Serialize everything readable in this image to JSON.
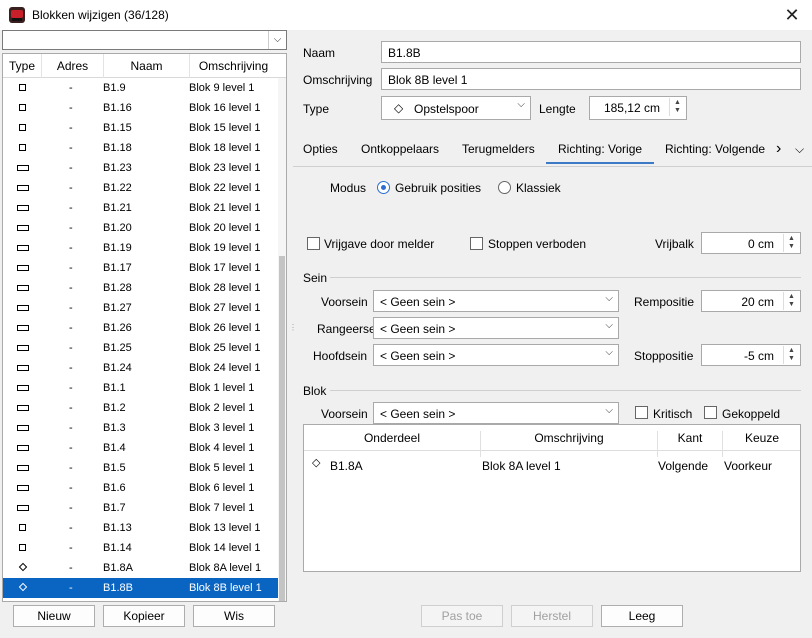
{
  "window": {
    "title": "Blokken wijzigen (36/128)",
    "close": "✕"
  },
  "filter": {
    "value": "",
    "arrow": "⌵"
  },
  "list": {
    "columns": [
      "Type",
      "Adres",
      "Naam",
      "Omschrijving"
    ],
    "rows": [
      {
        "icon": "square",
        "adres": "-",
        "naam": "B1.9",
        "oms": "Blok 9 level 1"
      },
      {
        "icon": "square",
        "adres": "-",
        "naam": "B1.16",
        "oms": "Blok 16 level 1"
      },
      {
        "icon": "square",
        "adres": "-",
        "naam": "B1.15",
        "oms": "Blok 15 level 1"
      },
      {
        "icon": "square",
        "adres": "-",
        "naam": "B1.18",
        "oms": "Blok 18 level 1"
      },
      {
        "icon": "rect",
        "adres": "-",
        "naam": "B1.23",
        "oms": "Blok 23 level 1"
      },
      {
        "icon": "rect",
        "adres": "-",
        "naam": "B1.22",
        "oms": "Blok 22 level 1"
      },
      {
        "icon": "rect",
        "adres": "-",
        "naam": "B1.21",
        "oms": "Blok 21 level 1"
      },
      {
        "icon": "rect",
        "adres": "-",
        "naam": "B1.20",
        "oms": "Blok 20 level 1"
      },
      {
        "icon": "rect",
        "adres": "-",
        "naam": "B1.19",
        "oms": "Blok 19 level 1"
      },
      {
        "icon": "rect",
        "adres": "-",
        "naam": "B1.17",
        "oms": "Blok 17 level 1"
      },
      {
        "icon": "rect",
        "adres": "-",
        "naam": "B1.28",
        "oms": "Blok 28 level 1"
      },
      {
        "icon": "rect",
        "adres": "-",
        "naam": "B1.27",
        "oms": "Blok 27 level 1"
      },
      {
        "icon": "rect",
        "adres": "-",
        "naam": "B1.26",
        "oms": "Blok 26 level 1"
      },
      {
        "icon": "rect",
        "adres": "-",
        "naam": "B1.25",
        "oms": "Blok 25 level 1"
      },
      {
        "icon": "rect",
        "adres": "-",
        "naam": "B1.24",
        "oms": "Blok 24 level 1"
      },
      {
        "icon": "rect",
        "adres": "-",
        "naam": "B1.1",
        "oms": "Blok 1 level 1"
      },
      {
        "icon": "rect",
        "adres": "-",
        "naam": "B1.2",
        "oms": "Blok 2 level 1"
      },
      {
        "icon": "rect",
        "adres": "-",
        "naam": "B1.3",
        "oms": "Blok 3 level 1"
      },
      {
        "icon": "rect",
        "adres": "-",
        "naam": "B1.4",
        "oms": "Blok 4 level 1"
      },
      {
        "icon": "rect",
        "adres": "-",
        "naam": "B1.5",
        "oms": "Blok 5 level 1"
      },
      {
        "icon": "rect",
        "adres": "-",
        "naam": "B1.6",
        "oms": "Blok 6 level 1"
      },
      {
        "icon": "rect",
        "adres": "-",
        "naam": "B1.7",
        "oms": "Blok 7 level 1"
      },
      {
        "icon": "square",
        "adres": "-",
        "naam": "B1.13",
        "oms": "Blok 13 level 1"
      },
      {
        "icon": "square",
        "adres": "-",
        "naam": "B1.14",
        "oms": "Blok 14 level 1"
      },
      {
        "icon": "diamond",
        "adres": "-",
        "naam": "B1.8A",
        "oms": "Blok 8A level 1"
      },
      {
        "icon": "diamond",
        "adres": "-",
        "naam": "B1.8B",
        "oms": "Blok 8B level 1",
        "selected": true
      }
    ]
  },
  "buttons": {
    "nieuw": "Nieuw",
    "kopieer": "Kopieer",
    "wis": "Wis",
    "pastoe": "Pas toe",
    "herstel": "Herstel",
    "leeg": "Leeg"
  },
  "form": {
    "naam_label": "Naam",
    "naam": "B1.8B",
    "oms_label": "Omschrijving",
    "oms": "Blok 8B level 1",
    "type_label": "Type",
    "type": "Opstelspoor",
    "type_icon": "◇",
    "lengte_label": "Lengte",
    "lengte": "185,12 cm"
  },
  "tabs": [
    "Opties",
    "Ontkoppelaars",
    "Terugmelders",
    "Richting: Vorige",
    "Richting: Volgende"
  ],
  "tab_more": "›",
  "tab_menu": "⌵",
  "richting": {
    "modus_label": "Modus",
    "opt1": "Gebruik posities",
    "opt2": "Klassiek",
    "vrijgave": "Vrijgave door melder",
    "stoppen": "Stoppen verboden",
    "vrijbalk_label": "Vrijbalk",
    "vrijbalk": "0 cm",
    "sein_header": "Sein",
    "voorsein_label": "Voorsein",
    "voorsein": "< Geen sein >",
    "rangeersein_label": "Rangeersein",
    "rangeersein": "< Geen sein >",
    "hoofdsein_label": "Hoofdsein",
    "hoofdsein": "< Geen sein >",
    "rempositie_label": "Rempositie",
    "rempositie": "20 cm",
    "stoppositie_label": "Stoppositie",
    "stoppositie": "-5 cm",
    "blok_header": "Blok",
    "blok_voorsein_label": "Voorsein",
    "blok_voorsein": "< Geen sein >",
    "kritisch": "Kritisch",
    "gekoppeld": "Gekoppeld"
  },
  "table": {
    "columns": [
      "Onderdeel",
      "Omschrijving",
      "Kant",
      "Keuze"
    ],
    "rows": [
      {
        "onderdeel": "B1.8A",
        "oms": "Blok 8A level 1",
        "kant": "Volgende",
        "keuze": "Voorkeur"
      }
    ]
  },
  "colors": {
    "selection": "#0a64c2",
    "accent": "#3c7ac8"
  }
}
